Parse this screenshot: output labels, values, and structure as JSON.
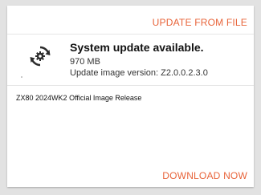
{
  "actions": {
    "update_from_file": "UPDATE FROM FILE",
    "download_now": "DOWNLOAD NOW"
  },
  "update": {
    "title": "System update available.",
    "size": "970 MB",
    "version": "Update image version: Z2.0.0.2.3.0"
  },
  "release": {
    "id": "ZX80 2024WK2",
    "description": "Official Image Release"
  },
  "icons": {
    "status": "sync-gear-icon"
  },
  "colors": {
    "accent": "#e8643a",
    "background": "#e2e2e2",
    "card": "#ffffff"
  }
}
